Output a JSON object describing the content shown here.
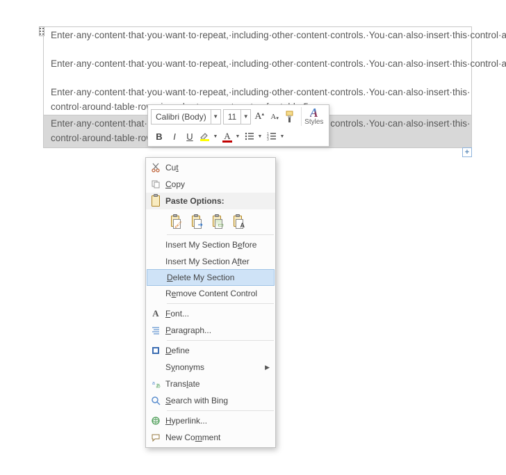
{
  "content": {
    "para1": "Enter·any·content·that·you·want·to·repeat,·including·other·content·controls.·You·can·also·insert·this·control·around·table·rows·in·order·to·repeat·parts·of·a·table.¶",
    "para2": "Enter·any·content·that·you·want·to·repeat,·including·other·content·controls.·You·can·also·insert·this·control·around·table·rows·in·order·to·repeat·parts·of·a·table.¶",
    "para3a": "Enter·any·content·that·you·want·to·repeat,·including·other·content·controls.·You·can·also·insert·this·",
    "para3b": "control·around·table·rows·in·order·to·repeat·parts·of·a·table.¶",
    "para4a": "Enter·any·content·that·you·want·to·repeat,·including·other·content·controls.·You·can·also·insert·this·",
    "para4b": "control·around·table·rows·in·order·to·repeat·parts·of·a·table.¶"
  },
  "add_button": "+",
  "mini_toolbar": {
    "font_name": "Calibri (Body)",
    "font_size": "11",
    "styles_label": "Styles",
    "bold": "B",
    "italic": "I",
    "underline": "U"
  },
  "context_menu": {
    "cut": "Cut",
    "copy": "Copy",
    "paste_title": "Paste Options:",
    "insert_before": "Insert My Section Before",
    "insert_after": "Insert My Section After",
    "delete_section": "Delete My Section",
    "remove_cc": "Remove Content Control",
    "font": "Font...",
    "paragraph": "Paragraph...",
    "define": "Define",
    "synonyms": "Synonyms",
    "translate": "Translate",
    "search_bing": "Search with Bing",
    "hyperlink": "Hyperlink...",
    "new_comment": "New Comment"
  }
}
